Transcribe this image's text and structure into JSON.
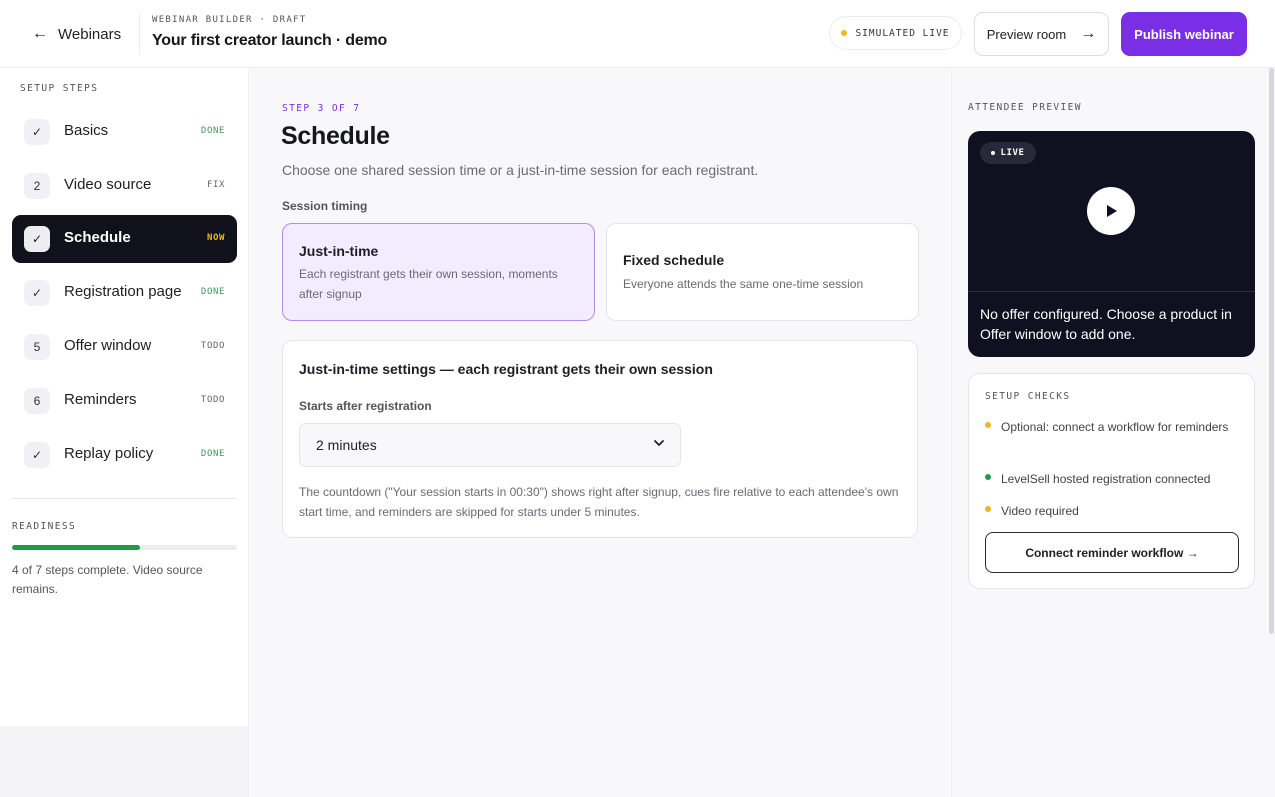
{
  "header": {
    "back_label": "Webinars",
    "breadcrumb": "WEBINAR BUILDER · DRAFT",
    "title": "Your first creator launch · demo",
    "mode_badge": "SIMULATED LIVE",
    "preview_label": "Preview room",
    "publish_label": "Publish webinar"
  },
  "sidebar": {
    "section_label": "SETUP STEPS",
    "steps": [
      {
        "badge": "✓",
        "label": "Basics",
        "status": "DONE"
      },
      {
        "badge": "2",
        "label": "Video source",
        "status": "FIX"
      },
      {
        "badge": "✓",
        "label": "Schedule",
        "status": "NOW"
      },
      {
        "badge": "✓",
        "label": "Registration page",
        "status": "DONE"
      },
      {
        "badge": "5",
        "label": "Offer window",
        "status": "TODO"
      },
      {
        "badge": "6",
        "label": "Reminders",
        "status": "TODO"
      },
      {
        "badge": "✓",
        "label": "Replay policy",
        "status": "DONE"
      }
    ],
    "readiness_label": "READINESS",
    "readiness_fraction": 0.57,
    "readiness_text": "4 of 7 steps complete. Video source remains."
  },
  "main": {
    "step_count": "STEP 3 OF 7",
    "title": "Schedule",
    "description": "Choose one shared session time or a just-in-time session for each registrant.",
    "timing_label": "Session timing",
    "options": [
      {
        "title": "Just-in-time",
        "description": "Each registrant gets their own session, moments after signup"
      },
      {
        "title": "Fixed schedule",
        "description": "Everyone attends the same one-time session"
      }
    ],
    "jit": {
      "title": "Just-in-time settings — each registrant gets their own session",
      "starts_label": "Starts after registration",
      "starts_value": "2 minutes",
      "note": "The countdown (\"Your session starts in 00:30\") shows right after signup, cues fire relative to each attendee's own start time, and reminders are skipped for starts under 5 minutes."
    }
  },
  "preview": {
    "label": "ATTENDEE PREVIEW",
    "live_label": "LIVE",
    "message": "No offer configured. Choose a product in Offer window to add one."
  },
  "checks": {
    "label": "SETUP CHECKS",
    "items": [
      {
        "text": "Optional: connect a workflow for reminders",
        "color": "#f0b71c"
      },
      {
        "text": "LevelSell hosted registration connected",
        "color": "#1f9a48"
      },
      {
        "text": "Video required",
        "color": "#f0b71c"
      }
    ],
    "connect_label": "Connect reminder workflow →"
  },
  "colors": {
    "accent": "#7a2ee6",
    "done": "#3e9a5a",
    "now": "#f0b71c",
    "progress": "#1f9a48"
  }
}
